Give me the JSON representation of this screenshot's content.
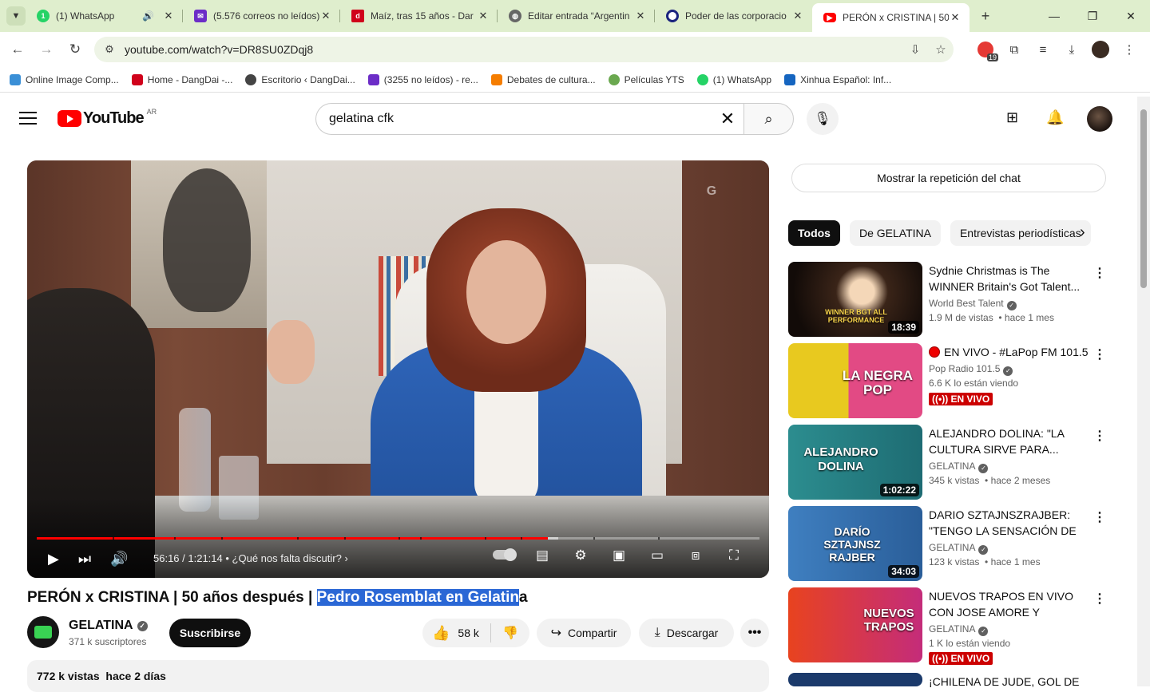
{
  "tabs": [
    {
      "title": "(1) WhatsApp",
      "color": "#25d366"
    },
    {
      "title": "(5.576 correos no leídos)",
      "color": "#6c2dc7"
    },
    {
      "title": "Maíz, tras 15 años - Dar",
      "color": "#d0021b"
    },
    {
      "title": "Editar entrada “Argentin",
      "color": "#555555"
    },
    {
      "title": "Poder de las corporacio",
      "color": "#1a237e"
    },
    {
      "title": "PERÓN x CRISTINA | 50",
      "color": "#ff0000"
    }
  ],
  "toolbar": {
    "url": "youtube.com/watch?v=DR8SU0ZDqj8",
    "ext_badge": "19"
  },
  "bookmarks": [
    {
      "label": "Online Image Comp...",
      "color": "#3a8fd6"
    },
    {
      "label": "Home - DangDai -...",
      "color": "#d0021b"
    },
    {
      "label": "Escritorio ‹ DangDai...",
      "color": "#444444"
    },
    {
      "label": "(3255 no leídos) - re...",
      "color": "#6c2dc7"
    },
    {
      "label": "Debates de cultura...",
      "color": "#f57d00"
    },
    {
      "label": "Películas YTS",
      "color": "#6aa84f"
    },
    {
      "label": "(1) WhatsApp",
      "color": "#25d366"
    },
    {
      "label": "Xinhua Español: Inf...",
      "color": "#1565c0"
    }
  ],
  "youtube": {
    "logo": "YouTube",
    "country": "AR",
    "search_query": "gelatina cfk"
  },
  "player": {
    "time": "56:16 / 1:21:14",
    "chapter": "• ¿Qué nos falta discutir?",
    "progress_played": 0.707,
    "progress_buffered": 0.722,
    "watermark": "G"
  },
  "video": {
    "title_plain": "PERÓN x CRISTINA | 50 años después | ",
    "title_selected": "Pedro Rosemblat en Gelatin",
    "title_tail": "a",
    "channel": "GELATINA",
    "subscribers": "371 k suscriptores",
    "subscribe": "Suscribirse",
    "likes": "58 k",
    "share": "Compartir",
    "download": "Descargar",
    "views_date": "772 k vistas  hace 2 días"
  },
  "sidebar": {
    "chat_replay": "Mostrar la repetición del chat",
    "chips": [
      "Todos",
      "De GELATINA",
      "Entrevistas periodísticas"
    ],
    "recs": [
      {
        "title": "Sydnie Christmas is The WINNER Britain's Got Talent...",
        "channel": "World Best Talent",
        "meta": "1.9 M de vistas  • hace 1 mes",
        "duration": "18:39",
        "thumb_text": "WINNER BGT ALL PERFORMANCE",
        "bg": "#2a1a12"
      },
      {
        "title": "EN VIVO - #LaPop FM 101.5",
        "channel": "Pop Radio 101.5",
        "meta": "6.6 K lo están viendo",
        "live": "((•)) EN VIVO",
        "thumb_text": "LA NEGRA POP",
        "bg": "#e8c91f"
      },
      {
        "title": "ALEJANDRO DOLINA: \"LA CULTURA SIRVE PARA...",
        "channel": "GELATINA",
        "meta": "345 k vistas  • hace 2 meses",
        "duration": "1:02:22",
        "thumb_text": "ALEJANDRO DOLINA",
        "bg": "#2c8d8f"
      },
      {
        "title": "DARIO SZTAJNSZRAJBER: \"TENGO LA SENSACIÓN DE Q...",
        "channel": "GELATINA",
        "meta": "123 k vistas  • hace 1 mes",
        "duration": "34:03",
        "thumb_text": "DARÍO SZTAJNSZ RAJBER",
        "bg": "#3f7fc0"
      },
      {
        "title": "NUEVOS TRAPOS EN VIVO CON JOSE AMORE Y OCTAVIO...",
        "channel": "GELATINA",
        "meta": "1 K lo están viendo",
        "live": "((•)) EN VIVO",
        "thumb_text": "NUEVOS TRAPOS",
        "bg": "#e8431f"
      },
      {
        "title": "¡CHILENA DE JUDE, GOL DE",
        "channel": "",
        "meta": "",
        "thumb_text": "",
        "bg": "#1b3a6b"
      }
    ]
  }
}
